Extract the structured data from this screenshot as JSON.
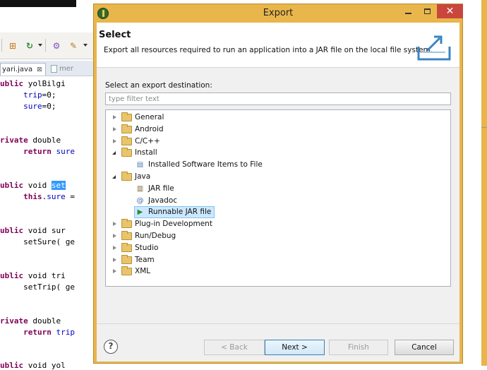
{
  "ide": {
    "tabs": [
      {
        "label": "yari.java",
        "close": "⊠"
      },
      {
        "label": "mer"
      }
    ],
    "code_lines": [
      {
        "kw": "ublic",
        "text": " yolBilgi"
      },
      {
        "indent": "     ",
        "fld": "trip",
        "text": "=0;"
      },
      {
        "indent": "     ",
        "fld": "sure",
        "text": "=0;"
      },
      {
        "kw": "rivate",
        "text": " double"
      },
      {
        "indent": "     ",
        "kw": "return",
        "fld": " sure"
      },
      {
        "kw": "ublic",
        "text": " void ",
        "sel": "set"
      },
      {
        "indent": "     ",
        "kw": "this",
        "text": ".",
        "fld": "sure",
        "text2": " ="
      },
      {
        "kw": "ublic",
        "text": " void sur"
      },
      {
        "indent": "     ",
        "text": "setSure( ge"
      },
      {
        "kw": "ublic",
        "text": " void tri"
      },
      {
        "indent": "     ",
        "text": "setTrip( ge"
      },
      {
        "kw": "rivate",
        "text": " double"
      },
      {
        "indent": "     ",
        "kw": "return",
        "fld": " trip"
      },
      {
        "kw": "ublic",
        "text": " void yol"
      }
    ]
  },
  "dialog": {
    "title": "Export",
    "close_glyph": "✕",
    "banner": {
      "title": "Select",
      "description": "Export all resources required to run an application into a JAR file on the local file system."
    },
    "destination_label": "Select an export destination:",
    "filter": {
      "placeholder": "type filter text",
      "value": ""
    },
    "tree": [
      {
        "label": "General",
        "type": "folder",
        "expanded": false
      },
      {
        "label": "Android",
        "type": "folder",
        "expanded": false
      },
      {
        "label": "C/C++",
        "type": "folder",
        "expanded": false
      },
      {
        "label": "Install",
        "type": "folder",
        "expanded": true
      },
      {
        "label": "Installed Software Items to File",
        "type": "child",
        "icon": "installed-software-icon"
      },
      {
        "label": "Java",
        "type": "folder",
        "expanded": true
      },
      {
        "label": "JAR file",
        "type": "child",
        "icon": "jar-file-icon"
      },
      {
        "label": "Javadoc",
        "type": "child",
        "icon": "javadoc-icon"
      },
      {
        "label": "Runnable JAR file",
        "type": "child",
        "icon": "runnable-jar-icon",
        "selected": true
      },
      {
        "label": "Plug-in Development",
        "type": "folder",
        "expanded": false
      },
      {
        "label": "Run/Debug",
        "type": "folder",
        "expanded": false
      },
      {
        "label": "Studio",
        "type": "folder",
        "expanded": false
      },
      {
        "label": "Team",
        "type": "folder",
        "expanded": false
      },
      {
        "label": "XML",
        "type": "folder",
        "expanded": false
      }
    ],
    "help_glyph": "?",
    "buttons": {
      "back": "< Back",
      "next": "Next >",
      "finish": "Finish",
      "cancel": "Cancel"
    }
  },
  "colors": {
    "dialog_frame": "#e9b64c",
    "close_button": "#c9463d",
    "selection": "#cce8ff"
  }
}
